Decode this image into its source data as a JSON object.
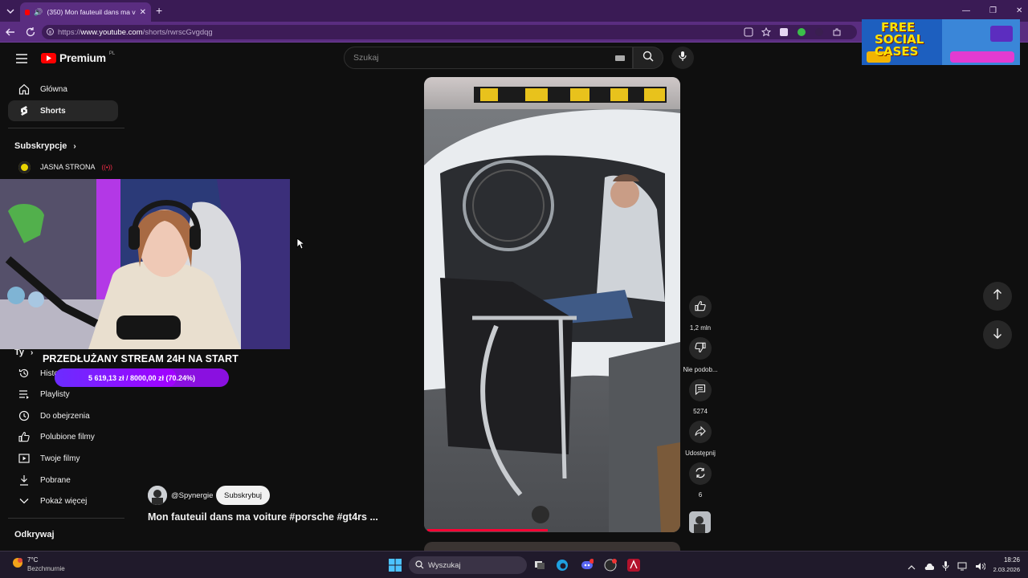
{
  "browser": {
    "tab_title": "(350) Mon fauteuil dans ma v",
    "new_tab": "+",
    "url_prefix": "https://",
    "url_host": "www.youtube.com",
    "url_path": "/shorts/rwrscGvgdqg"
  },
  "youtube": {
    "logo": "Premium",
    "logo_badge": "PL",
    "search_placeholder": "Szukaj",
    "sidebar_top": [
      {
        "label": "Główna",
        "icon": "home-icon"
      },
      {
        "label": "Shorts",
        "icon": "shorts-icon"
      }
    ],
    "subscriptions_heading": "Subskrypcje",
    "subscription_channel": "JASNA STRONA",
    "you_heading": "Ty",
    "you_items": [
      {
        "label": "Historia",
        "icon": "history-icon"
      },
      {
        "label": "Playlisty",
        "icon": "playlists-icon"
      },
      {
        "label": "Do obejrzenia",
        "icon": "watch-later-icon"
      },
      {
        "label": "Polubione filmy",
        "icon": "thumb-up-icon"
      },
      {
        "label": "Twoje filmy",
        "icon": "your-videos-icon"
      },
      {
        "label": "Pobrane",
        "icon": "download-icon"
      },
      {
        "label": "Pokaż więcej",
        "icon": "chevron-down-icon"
      }
    ],
    "explore_heading": "Odkrywaj",
    "short": {
      "channel": "@Spynergie",
      "subscribe": "Subskrybuj",
      "title": "Mon fauteuil dans ma voiture #porsche #gt4rs ...",
      "likes": "1,2 mln",
      "dislike": "Nie podob...",
      "comments": "5274",
      "share": "Udostępnij",
      "remix": "6"
    }
  },
  "overlay": {
    "goal_text": "PRZEDŁUŻANY STREAM 24H NA START",
    "goal_progress": "5 619,13 zł  /  8000,00 zł  (70.24%)",
    "goal_fraction": 0.7024,
    "promo_line1": "FREE",
    "promo_line2": "SOCIAL",
    "promo_line3": "CASES"
  },
  "taskbar": {
    "weather_temp": "7°C",
    "weather_desc": "Bezchmurnie",
    "search_label": "Wyszukaj",
    "time": "18:26",
    "date": "2.03.2026"
  }
}
